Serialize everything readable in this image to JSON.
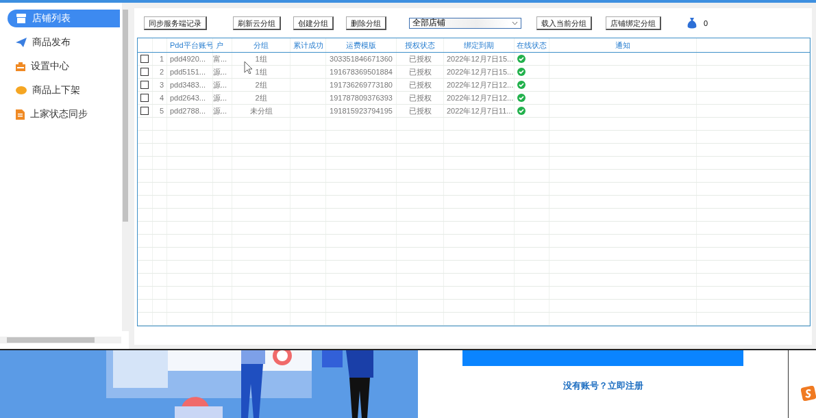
{
  "sidebar": {
    "items": [
      {
        "label": "店铺列表",
        "kind": "store",
        "selected": true
      },
      {
        "label": "商品发布",
        "kind": "plane",
        "selected": false
      },
      {
        "label": "设置中心",
        "kind": "box",
        "selected": false
      },
      {
        "label": "商品上下架",
        "kind": "coin",
        "selected": false
      },
      {
        "label": "上家状态同步",
        "kind": "doc",
        "selected": false
      }
    ]
  },
  "toolbar": {
    "buttons_left": [
      "同步服务端记录",
      "刷新云分组",
      "创建分组",
      "删除分组"
    ],
    "store_select": {
      "value": "全部店铺"
    },
    "buttons_right": [
      "载入当前分组",
      "店铺绑定分组"
    ],
    "balance": "0"
  },
  "table": {
    "columns": [
      "Pdd平台账号",
      "户",
      "分组",
      "累计成功",
      "运费模版",
      "授权状态",
      "绑定到期",
      "在线状态",
      "通知"
    ],
    "rows": [
      {
        "checked": false,
        "index": "1",
        "account": "pdd4920...",
        "column_2": "富...",
        "group": "1组",
        "success": "",
        "template": "303351846671360",
        "auth": "已授权",
        "expiry": "2022年12月7日15...",
        "online": true
      },
      {
        "checked": false,
        "index": "2",
        "account": "pdd5151...",
        "column_2": "源...",
        "group": "1组",
        "success": "",
        "template": "191678369501884",
        "auth": "已授权",
        "expiry": "2022年12月7日15...",
        "online": true
      },
      {
        "checked": false,
        "index": "3",
        "account": "pdd3483...",
        "column_2": "源...",
        "group": "2组",
        "success": "",
        "template": "191736269773180",
        "auth": "已授权",
        "expiry": "2022年12月7日12...",
        "online": true
      },
      {
        "checked": false,
        "index": "4",
        "account": "pdd2643...",
        "column_2": "源...",
        "group": "2组",
        "success": "",
        "template": "191787809376393",
        "auth": "已授权",
        "expiry": "2022年12月7日12...",
        "online": true
      },
      {
        "checked": false,
        "index": "5",
        "account": "pdd2788...",
        "column_2": "源...",
        "group": "未分组",
        "success": "",
        "template": "191815923794195",
        "auth": "已授权",
        "expiry": "2022年12月7日11...",
        "online": true
      }
    ]
  },
  "background_page": {
    "register_link": "没有账号？立即注册"
  }
}
